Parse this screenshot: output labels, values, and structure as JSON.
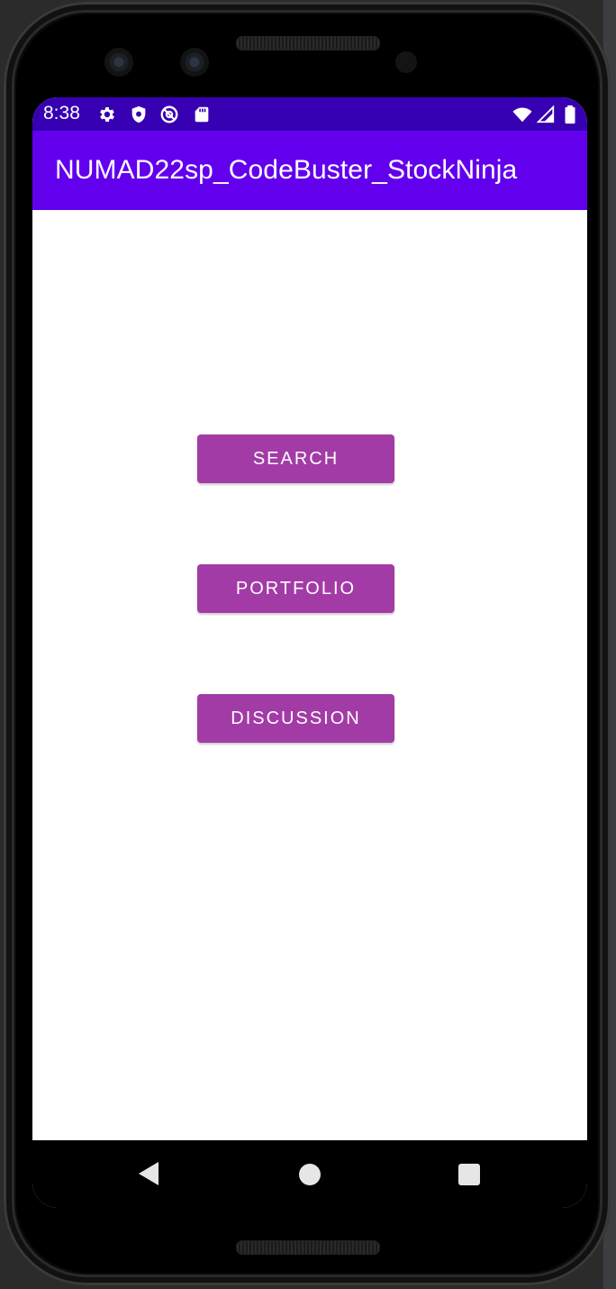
{
  "status_bar": {
    "time": "8:38",
    "icons_left": [
      "settings-gear-icon",
      "shield-icon",
      "at-sign-icon",
      "sd-card-icon"
    ],
    "icons_right": [
      "wifi-icon",
      "cell-signal-icon",
      "battery-icon"
    ],
    "color": "#3700b3"
  },
  "app_bar": {
    "title": "NUMAD22sp_CodeBuster_StockNinja",
    "color": "#6200ee"
  },
  "main": {
    "buttons": [
      {
        "label": "SEARCH"
      },
      {
        "label": "PORTFOLIO"
      },
      {
        "label": "DISCUSSION"
      }
    ],
    "button_color": "#a33ba6"
  },
  "nav_bar": {
    "icons": [
      "back-icon",
      "home-icon",
      "recents-icon"
    ]
  }
}
